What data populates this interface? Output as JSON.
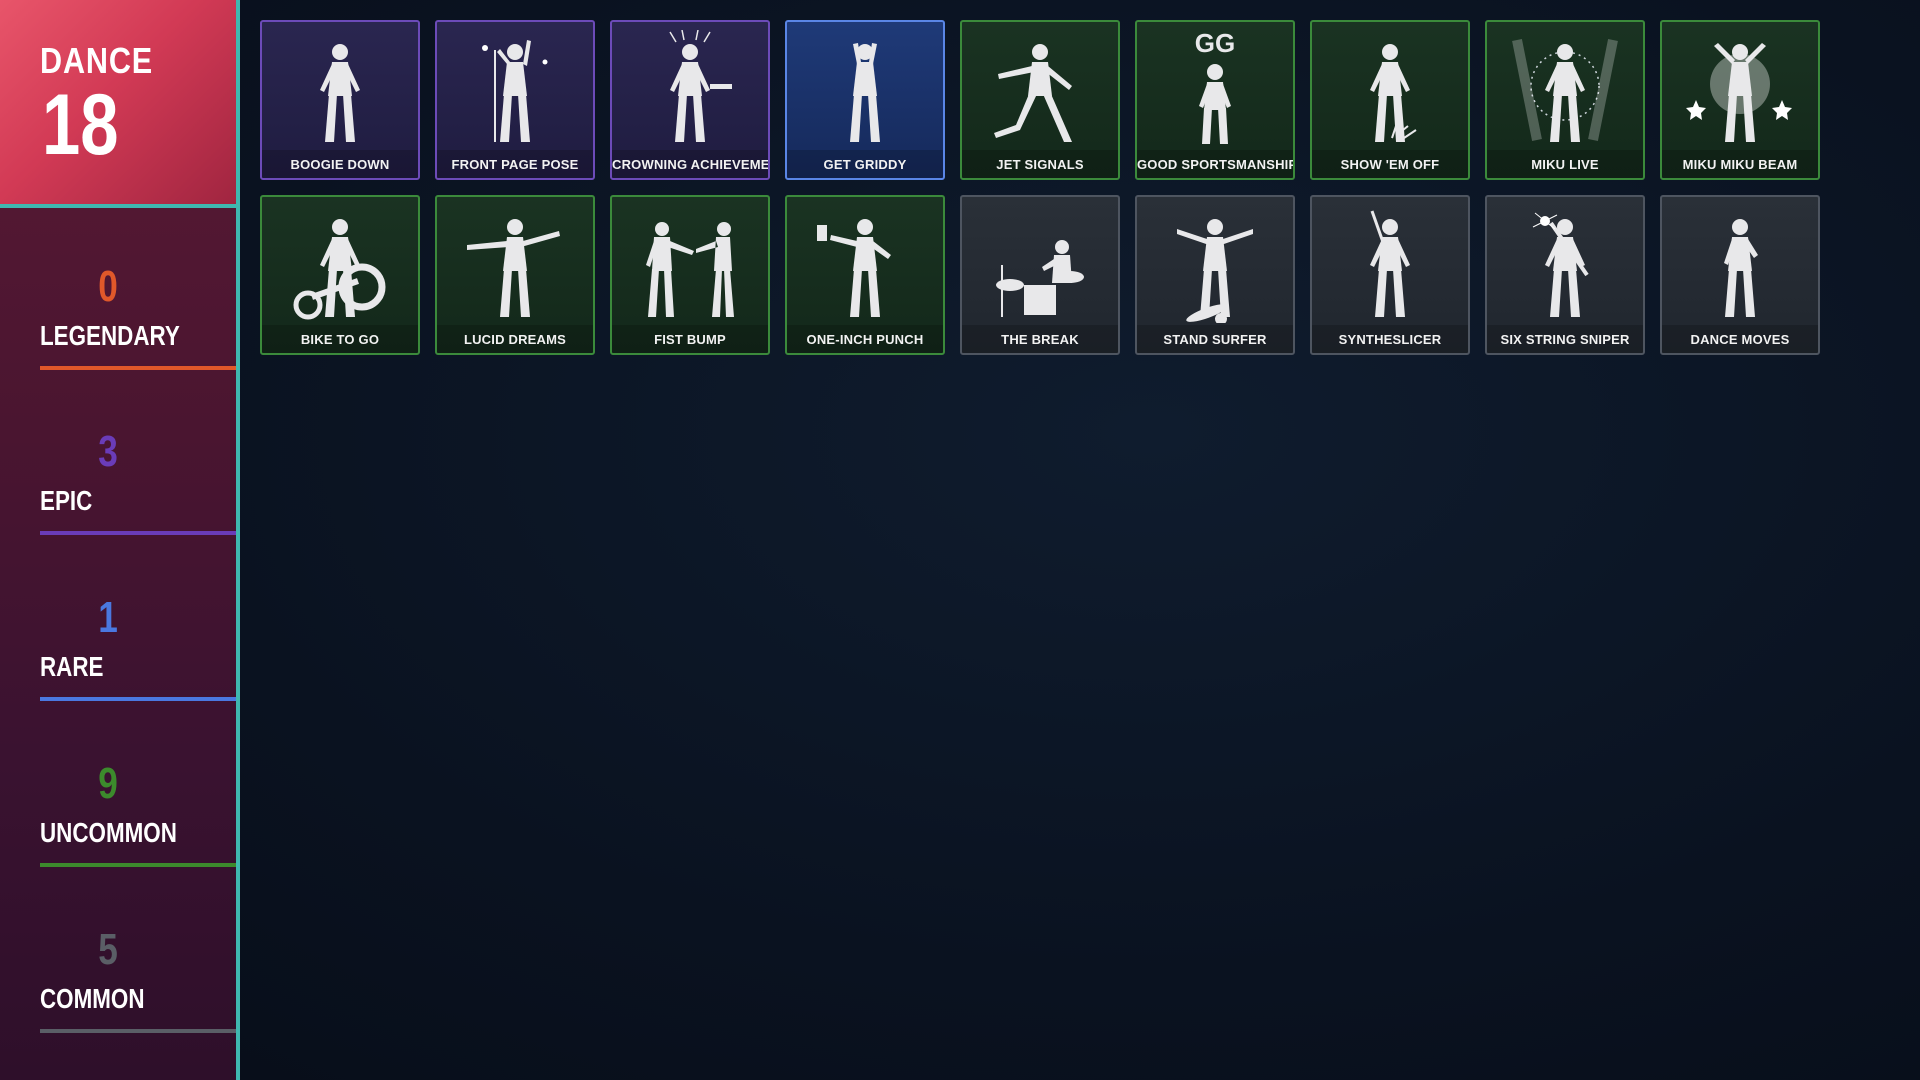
{
  "header": {
    "label": "DANCE",
    "count": "18"
  },
  "rarities": [
    {
      "count": "0",
      "label": "LEGENDARY",
      "color": "#e0582a"
    },
    {
      "count": "3",
      "label": "EPIC",
      "color": "#6a3cb8"
    },
    {
      "count": "1",
      "label": "RARE",
      "color": "#4a78e0"
    },
    {
      "count": "9",
      "label": "UNCOMMON",
      "color": "#3c8a2c"
    },
    {
      "count": "5",
      "label": "COMMON",
      "color": "#5a5e66"
    }
  ],
  "items": [
    {
      "name": "BOOGIE DOWN",
      "rarity": "epic",
      "icon": "dancer-icon"
    },
    {
      "name": "FRONT PAGE POSE",
      "rarity": "epic",
      "icon": "mic-stand-icon"
    },
    {
      "name": "CROWNING ACHIEVEMENT",
      "rarity": "epic",
      "icon": "crown-icon"
    },
    {
      "name": "GET GRIDDY",
      "rarity": "rare",
      "icon": "griddy-icon"
    },
    {
      "name": "JET SIGNALS",
      "rarity": "uncommon",
      "icon": "pose-icon"
    },
    {
      "name": "GOOD SPORTSMANSHIP",
      "rarity": "uncommon",
      "icon": "gg-icon"
    },
    {
      "name": "SHOW 'EM OFF",
      "rarity": "uncommon",
      "icon": "crouch-icon"
    },
    {
      "name": "MIKU LIVE",
      "rarity": "uncommon",
      "icon": "spotlight-icon"
    },
    {
      "name": "MIKU MIKU BEAM",
      "rarity": "uncommon",
      "icon": "star-beam-icon"
    },
    {
      "name": "BIKE TO GO",
      "rarity": "uncommon",
      "icon": "bike-icon"
    },
    {
      "name": "LUCID DREAMS",
      "rarity": "uncommon",
      "icon": "arms-out-icon"
    },
    {
      "name": "FIST BUMP",
      "rarity": "uncommon",
      "icon": "fist-bump-icon"
    },
    {
      "name": "ONE-INCH PUNCH",
      "rarity": "uncommon",
      "icon": "punch-icon"
    },
    {
      "name": "THE BREAK",
      "rarity": "common",
      "icon": "drums-icon"
    },
    {
      "name": "STAND SURFER",
      "rarity": "common",
      "icon": "surfer-icon"
    },
    {
      "name": "SYNTHESLICER",
      "rarity": "common",
      "icon": "sword-icon"
    },
    {
      "name": "SIX STRING SNIPER",
      "rarity": "common",
      "icon": "guitar-icon"
    },
    {
      "name": "DANCE MOVES",
      "rarity": "common",
      "icon": "dance-moves-icon"
    }
  ]
}
